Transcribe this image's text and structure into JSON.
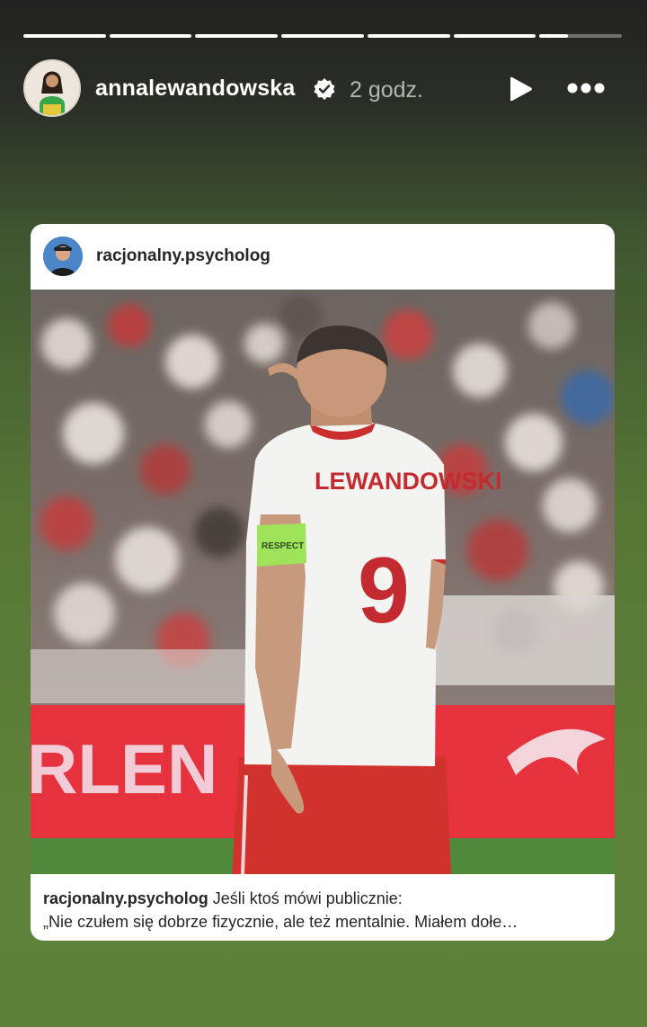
{
  "story": {
    "segments": [
      1,
      1,
      1,
      1,
      1,
      1,
      0.35
    ],
    "username": "annalewandowska",
    "time": "2 godz.",
    "icons": {
      "verified": "verified-badge-icon",
      "play": "play-icon",
      "more": "more-options-icon"
    }
  },
  "post": {
    "username": "racjonalny.psycholog",
    "caption_user": "racjonalny.psycholog",
    "caption_first": "Jeśli ktoś mówi publicznie:",
    "caption_second": "„Nie czułem się dobrze fizycznie, ale też mentalnie. Miałem dołe…",
    "photo": {
      "jersey_name": "LEWANDOWSKI",
      "jersey_number": "9",
      "armband_text": "RESPECT",
      "banner_text": "RLEN"
    }
  },
  "colors": {
    "top": "#222222",
    "bottom": "#5e8139",
    "jersey_red": "#c9343a",
    "armband": "#9fe35a"
  }
}
